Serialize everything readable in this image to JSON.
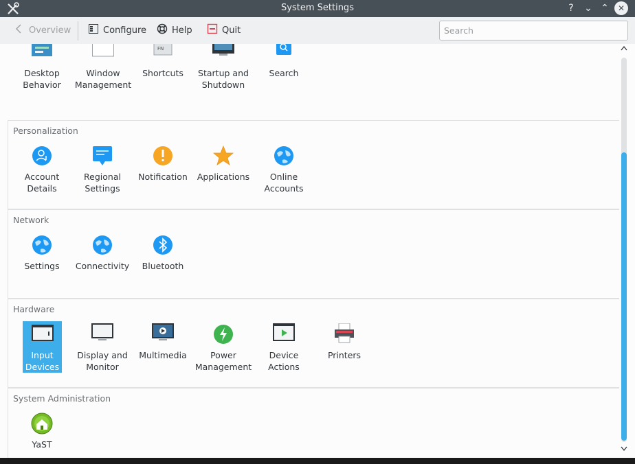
{
  "window": {
    "title": "System Settings",
    "controls": [
      "?",
      "⌄",
      "⌃",
      "✕"
    ]
  },
  "toolbar": {
    "overview_label": "Overview",
    "configure_label": "Configure",
    "help_label": "Help",
    "quit_label": "Quit",
    "search_placeholder": "Search"
  },
  "colors": {
    "accent": "#3daee9",
    "titlebar": "#475057",
    "background": "#fcfcfc",
    "text": "#31363b"
  },
  "top_row": [
    {
      "label": "Desktop\nBehavior",
      "icon": "desktop-behavior-icon"
    },
    {
      "label": "Window\nManagement",
      "icon": "window-management-icon"
    },
    {
      "label": "Shortcuts",
      "icon": "shortcuts-icon"
    },
    {
      "label": "Startup and\nShutdown",
      "icon": "startup-shutdown-icon"
    },
    {
      "label": "Search",
      "icon": "search-icon"
    }
  ],
  "sections": [
    {
      "title": "Personalization",
      "items": [
        {
          "label": "Account\nDetails",
          "icon": "account-icon"
        },
        {
          "label": "Regional\nSettings",
          "icon": "regional-icon"
        },
        {
          "label": "Notification",
          "icon": "notification-icon"
        },
        {
          "label": "Applications",
          "icon": "star-icon"
        },
        {
          "label": "Online\nAccounts",
          "icon": "globe-icon"
        }
      ]
    },
    {
      "title": "Network",
      "items": [
        {
          "label": "Settings",
          "icon": "globe-icon"
        },
        {
          "label": "Connectivity",
          "icon": "globe-icon"
        },
        {
          "label": "Bluetooth",
          "icon": "bluetooth-icon"
        }
      ]
    },
    {
      "title": "Hardware",
      "items": [
        {
          "label": "Input\nDevices",
          "icon": "input-devices-icon",
          "selected": true
        },
        {
          "label": "Display and\nMonitor",
          "icon": "monitor-icon"
        },
        {
          "label": "Multimedia",
          "icon": "multimedia-icon"
        },
        {
          "label": "Power\nManagement",
          "icon": "power-icon"
        },
        {
          "label": "Device\nActions",
          "icon": "device-actions-icon"
        },
        {
          "label": "Printers",
          "icon": "printer-icon"
        }
      ]
    },
    {
      "title": "System Administration",
      "items": [
        {
          "label": "YaST",
          "icon": "yast-icon"
        }
      ]
    }
  ]
}
